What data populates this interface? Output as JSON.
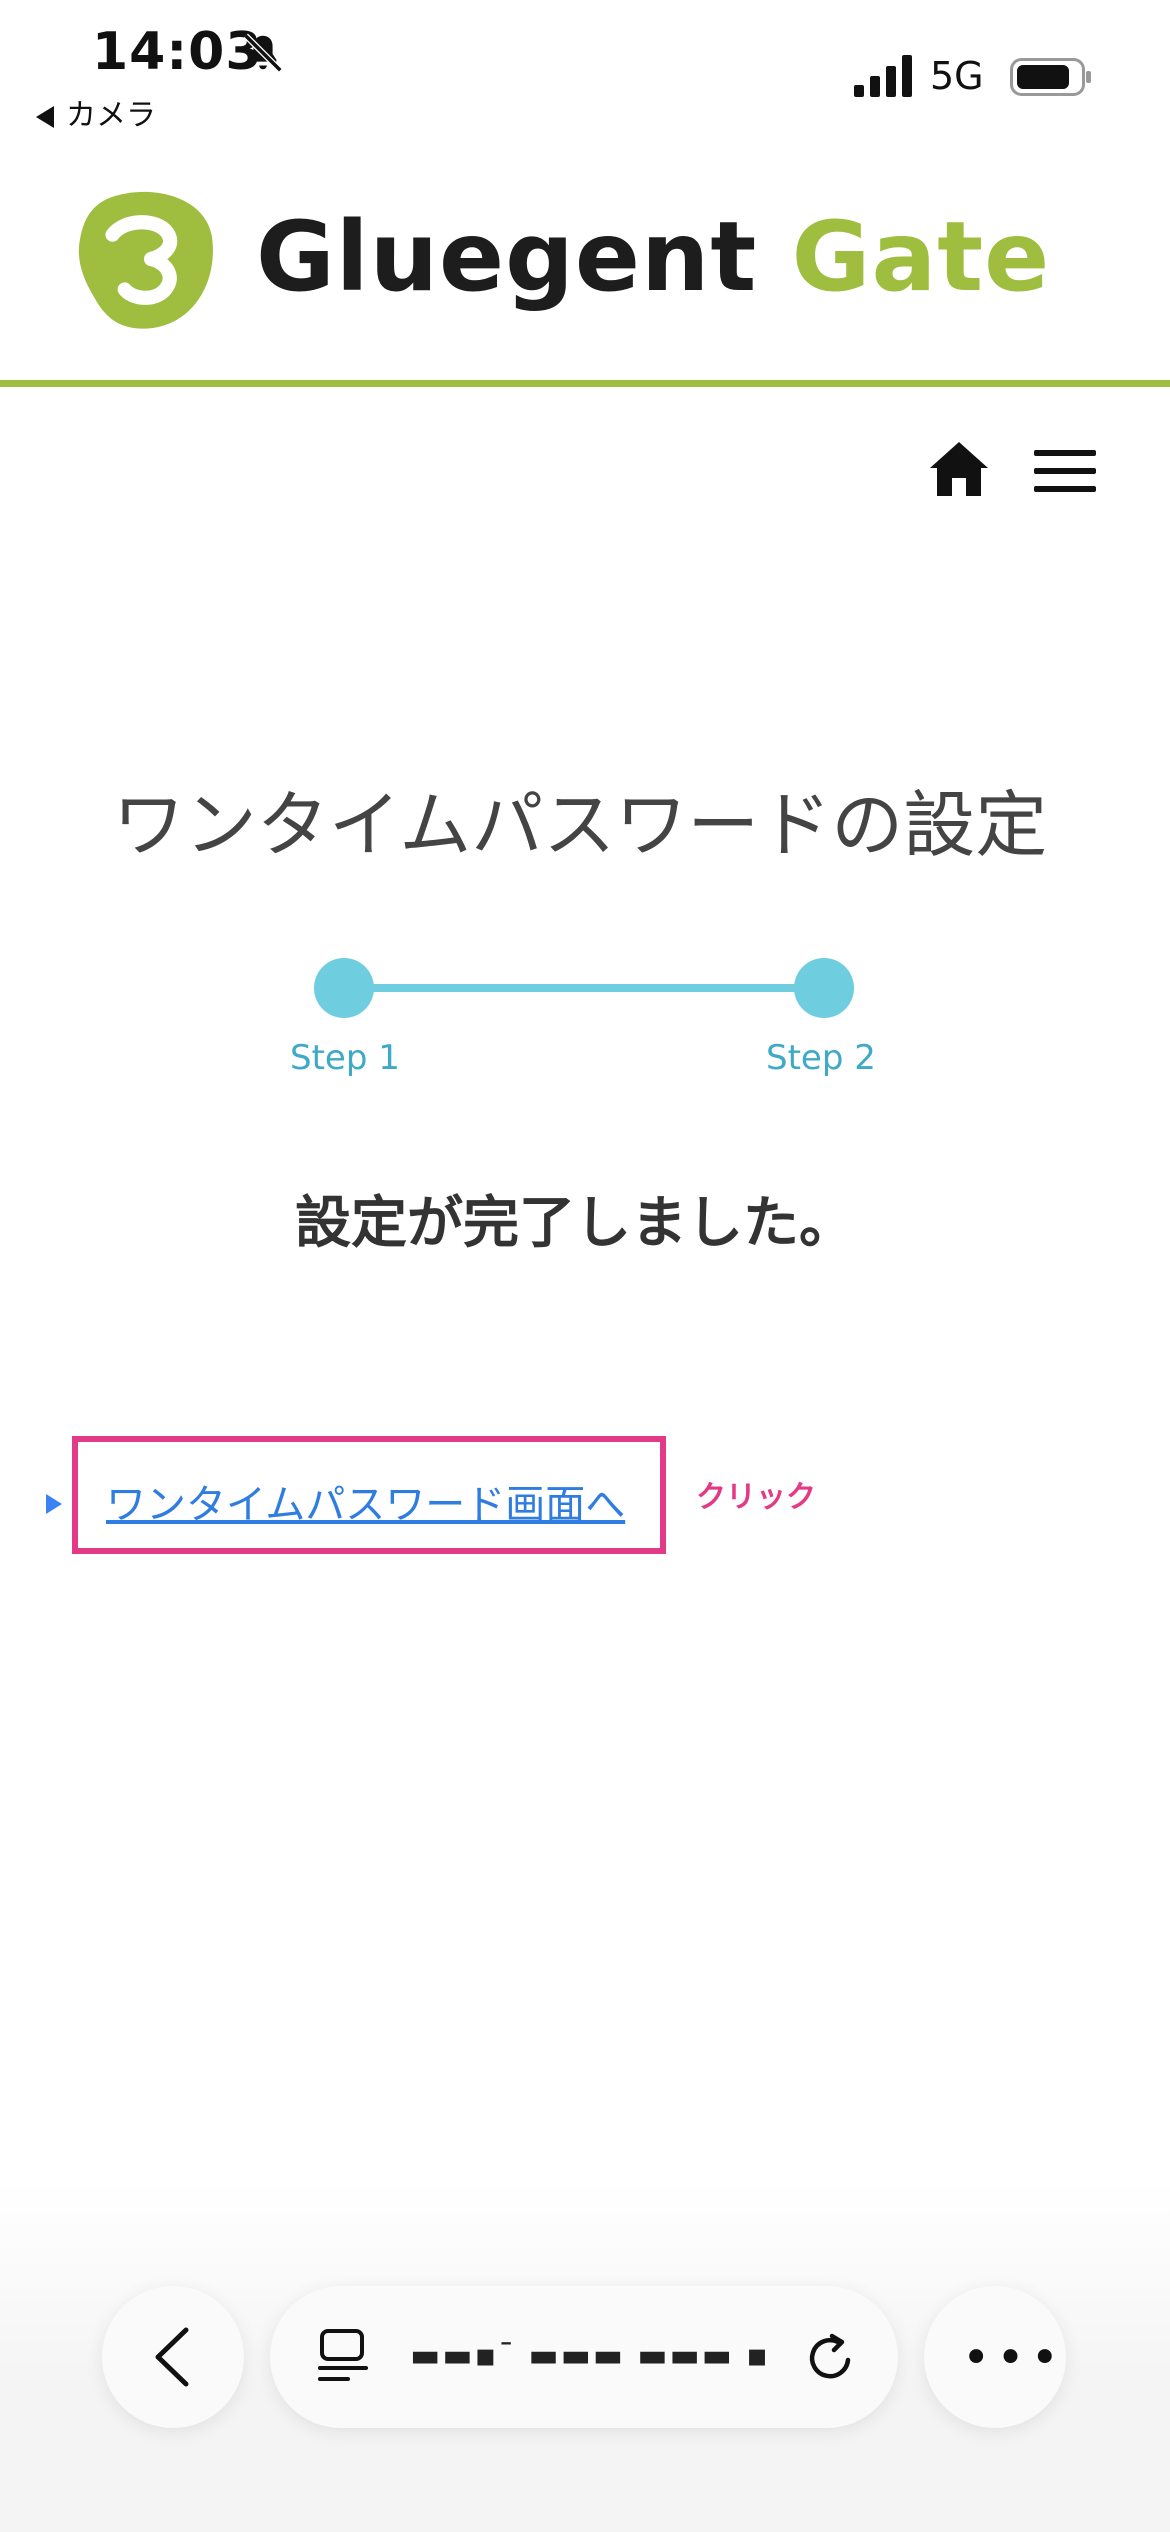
{
  "status_bar": {
    "time": "14:03",
    "back_app": "カメラ",
    "network": "5G"
  },
  "header": {
    "brand_part1": "Gluegent",
    "brand_part2": "Gate",
    "brand_color": "#9fbe3f"
  },
  "nav": {
    "icons": [
      "home-icon",
      "menu-icon"
    ]
  },
  "main": {
    "title": "ワンタイムパスワードの設定",
    "steps": [
      {
        "label": "Step 1"
      },
      {
        "label": "Step 2"
      }
    ],
    "message": "設定が完了しました。",
    "link_label": "ワンタイムパスワード画面へ",
    "annotation": "クリック",
    "annotation_color": "#e23a86",
    "link_color": "#2f7de1",
    "step_color": "#6fcde0"
  },
  "browser": {
    "url": "▬▬▪ˉ ▬▬▬ ▬▬▬ ▪",
    "icons": [
      "back-icon",
      "tabs-icon",
      "reload-icon",
      "more-icon"
    ]
  }
}
